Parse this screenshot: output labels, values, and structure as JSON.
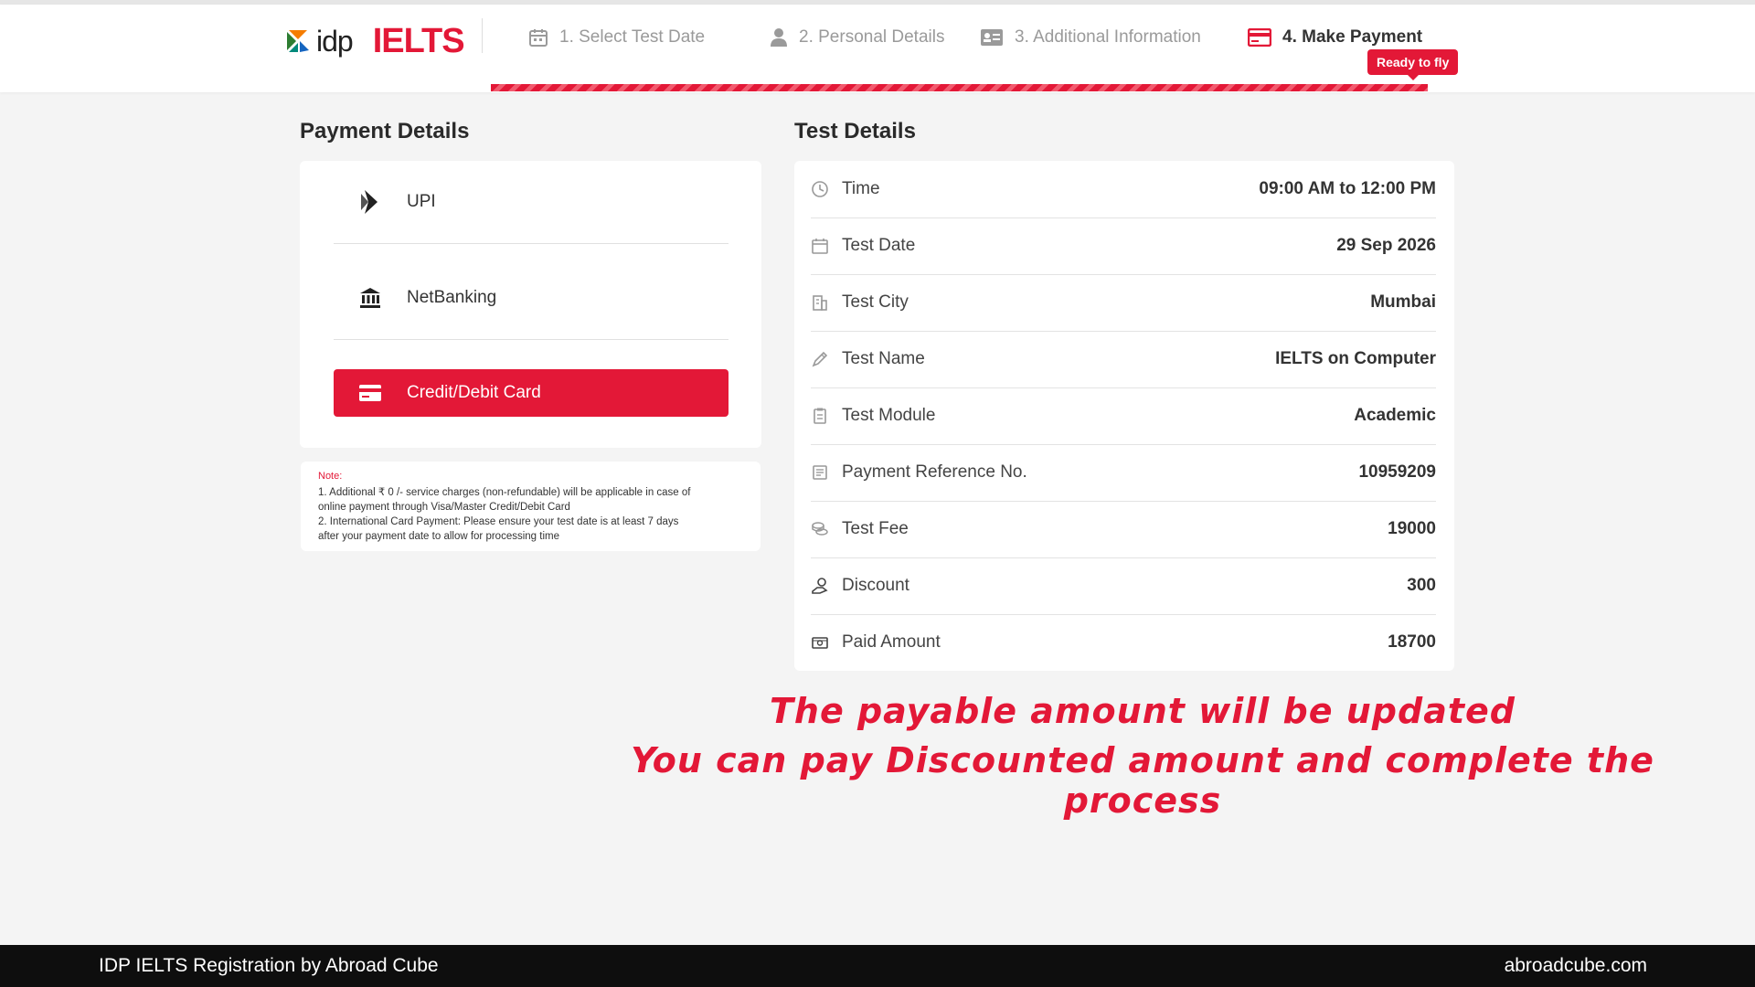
{
  "header": {
    "logo_idp": "idp",
    "logo_ielts": "IELTS",
    "steps": [
      {
        "label": "1. Select Test Date"
      },
      {
        "label": "2. Personal Details"
      },
      {
        "label": "3. Additional Information"
      },
      {
        "label": "4. Make Payment"
      }
    ],
    "badge": "Ready to fly"
  },
  "payment": {
    "title": "Payment Details",
    "options": [
      {
        "label": "UPI"
      },
      {
        "label": "NetBanking"
      },
      {
        "label": "Credit/Debit Card"
      }
    ],
    "note_title": "Note:",
    "note_lines": [
      "1. Additional ₹ 0 /- service charges (non-refundable) will be applicable in case of",
      "online payment through Visa/Master Credit/Debit Card",
      "2. International Card Payment: Please ensure your test date is at least 7 days",
      "after your payment date to allow for processing time"
    ]
  },
  "test": {
    "title": "Test Details",
    "rows": [
      {
        "label": "Time",
        "value": "09:00 AM to 12:00 PM"
      },
      {
        "label": "Test Date",
        "value": "29 Sep 2026"
      },
      {
        "label": "Test City",
        "value": "Mumbai"
      },
      {
        "label": "Test Name",
        "value": "IELTS on Computer"
      },
      {
        "label": "Test Module",
        "value": "Academic"
      },
      {
        "label": "Payment Reference No.",
        "value": "10959209"
      },
      {
        "label": "Test Fee",
        "value": "19000"
      },
      {
        "label": "Discount",
        "value": "300"
      },
      {
        "label": "Paid Amount",
        "value": "18700"
      }
    ]
  },
  "overlay": {
    "line1": "The payable amount will be updated",
    "line2": "You can pay Discounted amount and complete the process"
  },
  "footer": {
    "left": "IDP IELTS Registration by Abroad Cube",
    "right": "abroadcube.com"
  },
  "colors": {
    "accent": "#e31837"
  }
}
